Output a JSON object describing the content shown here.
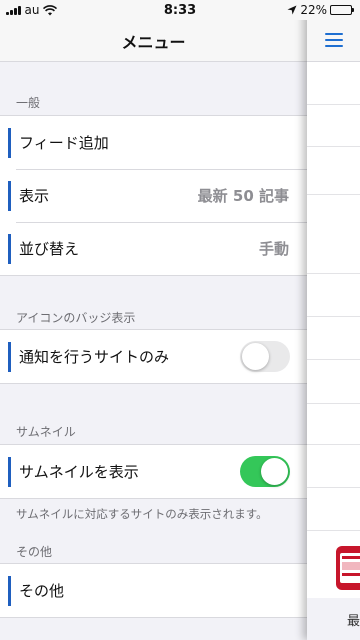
{
  "status_bar": {
    "carrier": "au",
    "time": "8:33",
    "battery_percent": "22%",
    "battery_level": 0.22,
    "icons": [
      "signal-icon",
      "wifi-icon",
      "location-arrow-icon",
      "battery-icon"
    ]
  },
  "menu": {
    "title": "メニュー",
    "sections": {
      "general": {
        "header": "一般",
        "rows": {
          "add_feed": {
            "label": "フィード追加"
          },
          "display": {
            "label": "表示",
            "value": "最新 50 記事"
          },
          "sort": {
            "label": "並び替え",
            "value": "手動"
          }
        }
      },
      "badge": {
        "header": "アイコンのバッジ表示",
        "rows": {
          "notify_only": {
            "label": "通知を行うサイトのみ",
            "enabled": false
          }
        }
      },
      "thumbnail": {
        "header": "サムネイル",
        "rows": {
          "show": {
            "label": "サムネイルを表示",
            "enabled": true
          }
        },
        "note": "サムネイルに対応するサイトのみ表示されます。"
      },
      "other": {
        "header": "その他",
        "rows": {
          "other": {
            "label": "その他"
          }
        }
      }
    }
  },
  "content_panel": {
    "menu_icon": "hamburger-menu-icon",
    "footer_fragment": "最"
  },
  "colors": {
    "accent_bar": "#1f5fbf",
    "toggle_on": "#34c759",
    "toggle_off": "#e9e9ea",
    "hamburger": "#1f6fd1"
  }
}
